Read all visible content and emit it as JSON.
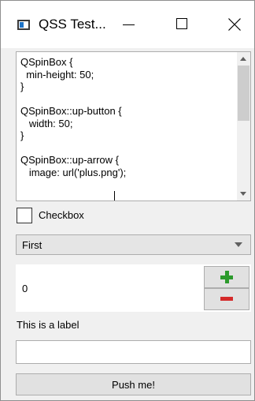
{
  "window": {
    "title": "QSS Test..."
  },
  "titlebar_buttons": {
    "minimize_icon": "minimize-icon",
    "maximize_icon": "maximize-icon",
    "close_icon": "close-icon"
  },
  "editor": {
    "content": "QSpinBox {\n  min-height: 50;\n}\n\nQSpinBox::up-button {\n   width: 50;\n}\n\nQSpinBox::up-arrow {\n   image: url('plus.png');"
  },
  "checkbox": {
    "label": "Checkbox",
    "checked": false
  },
  "combo": {
    "selected": "First"
  },
  "spinbox": {
    "value": "0",
    "up_icon": "plus-icon",
    "down_icon": "minus-icon",
    "up_color": "#2c9a2c",
    "down_color": "#d42a2a"
  },
  "label": {
    "text": "This is a label"
  },
  "line_edit": {
    "value": ""
  },
  "push_button": {
    "label": "Push me!"
  }
}
